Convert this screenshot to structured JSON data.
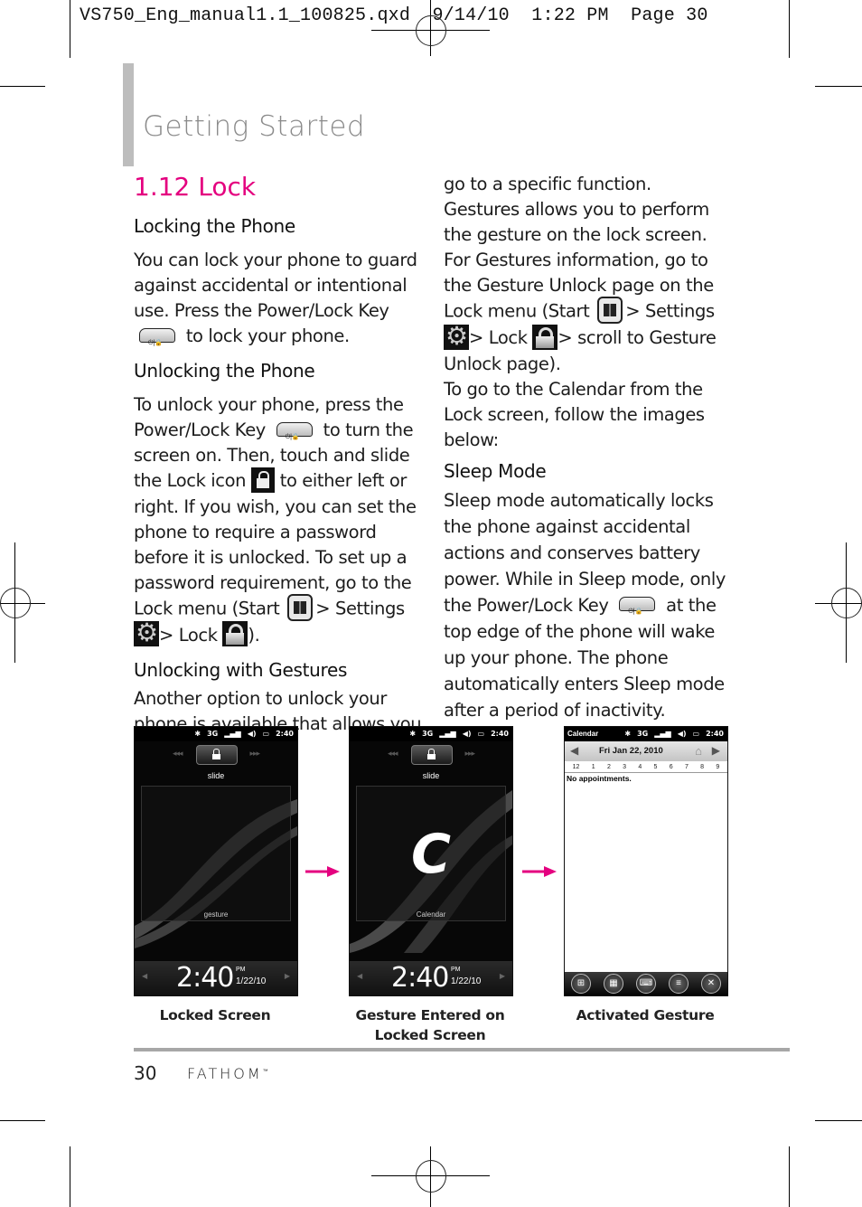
{
  "slug": {
    "filename": "VS750_Eng_manual1.1_100825.qxd",
    "date": "9/14/10",
    "time": "1:22 PM",
    "page_label": "Page 30"
  },
  "header": {
    "section_title": "Getting Started",
    "chapter_title": "1.12 Lock"
  },
  "left_column": {
    "locking_heading": "Locking the Phone",
    "locking_text_1": "You can lock your phone to guard against accidental or intentional use. Press the Power/Lock Key",
    "locking_text_2": "to lock your phone.",
    "unlocking_heading": "Unlocking the Phone",
    "unlocking_text_1": "To unlock your phone, press the Power/Lock Key",
    "unlocking_text_2": "to turn the screen on. Then, touch and slide the Lock icon",
    "unlocking_text_3": "to either left or right. If you wish, you can set the phone to require a password before it is unlocked. To set up a password requirement, go to the Lock menu (Start",
    "settings_label": "> Settings",
    "lock_label": "> Lock",
    "unlocking_close": ").",
    "gestures_heading": "Unlocking with Gestures",
    "gestures_text": "Another option to unlock your phone is available that allows you to"
  },
  "right_column": {
    "gestures_cont_1": "go to a specific function. Gestures allows you to perform the gesture on the lock screen. For Gestures information, go to the Gesture Unlock page on the Lock menu (Start",
    "settings_label": "> Settings",
    "lock_label": "> Lock",
    "gestures_cont_2": "> scroll to Gesture Unlock page).",
    "calendar_text": "To go to the Calendar from the Lock screen, follow the images below:",
    "sleep_heading": "Sleep Mode",
    "sleep_text_1": "Sleep mode automatically locks the phone against accidental actions and conserves battery power. While in Sleep mode, only the Power/Lock Key",
    "sleep_text_2": "at the top edge of the phone will wake up your phone. The phone automatically enters Sleep mode after a period of inactivity."
  },
  "icons": {
    "power_key": "power-lock-key-icon",
    "lock": "lock-icon",
    "start": "windows-start-icon",
    "settings": "gear-icon",
    "lock_menu": "padlock-icon"
  },
  "screens": {
    "status_time": "2:40",
    "status_network": "3G",
    "slide_label": "slide",
    "left_arrows": "◂◂◂",
    "right_arrows": "▸▸▸",
    "clock_time": "2:40",
    "clock_ampm": "PM",
    "clock_date": "1/22/10",
    "locked": {
      "pad_label": "gesture",
      "caption": "Locked Screen"
    },
    "gesture": {
      "gesture_glyph": "C",
      "pad_label": "Calendar",
      "caption_line1": "Gesture Entered on",
      "caption_line2": "Locked Screen"
    },
    "calendar": {
      "title": "Calendar",
      "date": "Fri   Jan 22, 2010",
      "hours": [
        "12",
        "1",
        "2",
        "3",
        "4",
        "5",
        "6",
        "7",
        "8",
        "9"
      ],
      "empty_message": "No appointments.",
      "caption": "Activated Gesture"
    }
  },
  "colors": {
    "accent": "#e4007f",
    "section_gray": "#8a8a8a",
    "rule_gray": "#a7a7a7"
  },
  "footer": {
    "page_number": "30",
    "brand": "FATHOM",
    "trademark": "™"
  }
}
